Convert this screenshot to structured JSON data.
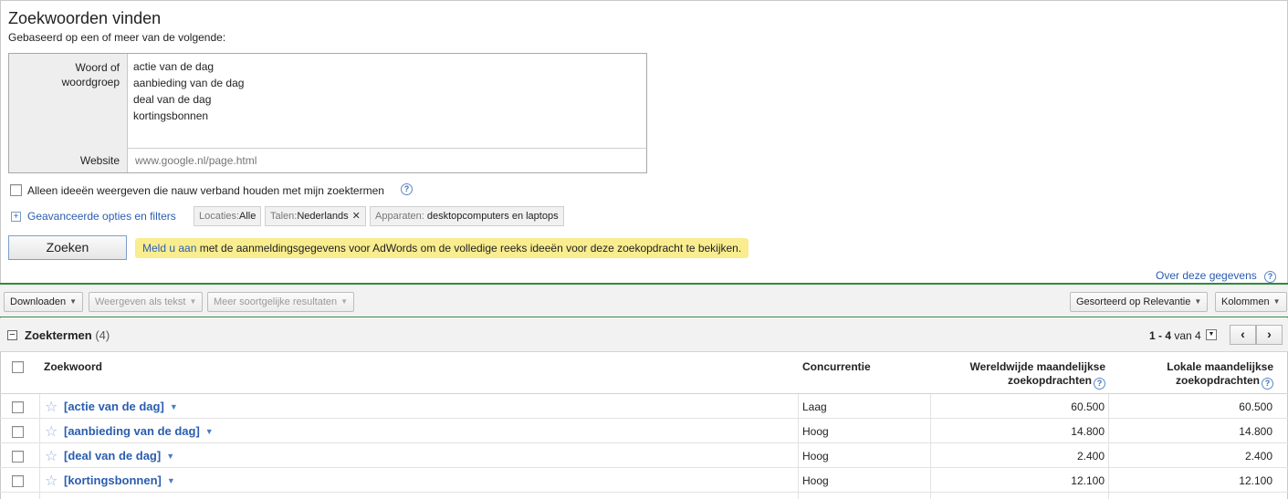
{
  "header": {
    "title": "Zoekwoorden vinden",
    "subtitle": "Gebaseerd op een of meer van de volgende:"
  },
  "input": {
    "keyword_label": "Woord of woordgroep",
    "keywords": [
      "actie van de dag",
      "aanbieding van de dag",
      "deal van de dag",
      "kortingsbonnen"
    ],
    "website_label": "Website",
    "website_placeholder": "www.google.nl/page.html"
  },
  "filters": {
    "related_only_label": "Alleen ideeën weergeven die nauw verband houden met mijn zoektermen",
    "advanced_link": "Geavanceerde opties en filters",
    "chips": [
      {
        "key": "Locaties:",
        "value": "Alle"
      },
      {
        "key": "Talen:",
        "value": "Nederlands",
        "close": "✕"
      },
      {
        "key": "Apparaten:",
        "value": "desktopcomputers en laptops"
      }
    ]
  },
  "search_button": "Zoeken",
  "notice": {
    "link": "Meld u aan",
    "text": "met de aanmeldingsgegevens voor AdWords om de volledige reeks ideeën voor deze zoekopdracht te bekijken."
  },
  "about_link": "Over deze gegevens",
  "toolbar": {
    "download": "Downloaden",
    "view_as_text": "Weergeven als tekst",
    "more_similar": "Meer soortgelijke resultaten",
    "sorted_by": "Gesorteerd op Relevantie",
    "columns": "Kolommen"
  },
  "section": {
    "title": "Zoektermen",
    "count": "(4)",
    "pager_range": "1 - 4",
    "pager_of": "van 4"
  },
  "table": {
    "headers": {
      "keyword": "Zoekwoord",
      "competition": "Concurrentie",
      "global_line1": "Wereldwijde maandelijkse",
      "global_line2": "zoekopdrachten",
      "local_line1": "Lokale maandelijkse",
      "local_line2": "zoekopdrachten"
    },
    "rows": [
      {
        "keyword": "[actie van de dag]",
        "competition": "Laag",
        "global": "60.500",
        "local": "60.500"
      },
      {
        "keyword": "[aanbieding van de dag]",
        "competition": "Hoog",
        "global": "14.800",
        "local": "14.800"
      },
      {
        "keyword": "[deal van de dag]",
        "competition": "Hoog",
        "global": "2.400",
        "local": "2.400"
      },
      {
        "keyword": "[kortingsbonnen]",
        "competition": "Hoog",
        "global": "12.100",
        "local": "12.100"
      }
    ]
  },
  "icons": {
    "help": "question-mark-circle-icon",
    "star": "star-outline-icon",
    "expand": "plus-box-icon",
    "collapse": "minus-box-icon",
    "dropdown": "caret-down-icon",
    "prev": "chevron-left-icon",
    "next": "chevron-right-icon"
  },
  "colors": {
    "link": "#2a5db0",
    "notice_bg": "#f9ed8f",
    "toolbar_accent": "#2e8a3a"
  }
}
